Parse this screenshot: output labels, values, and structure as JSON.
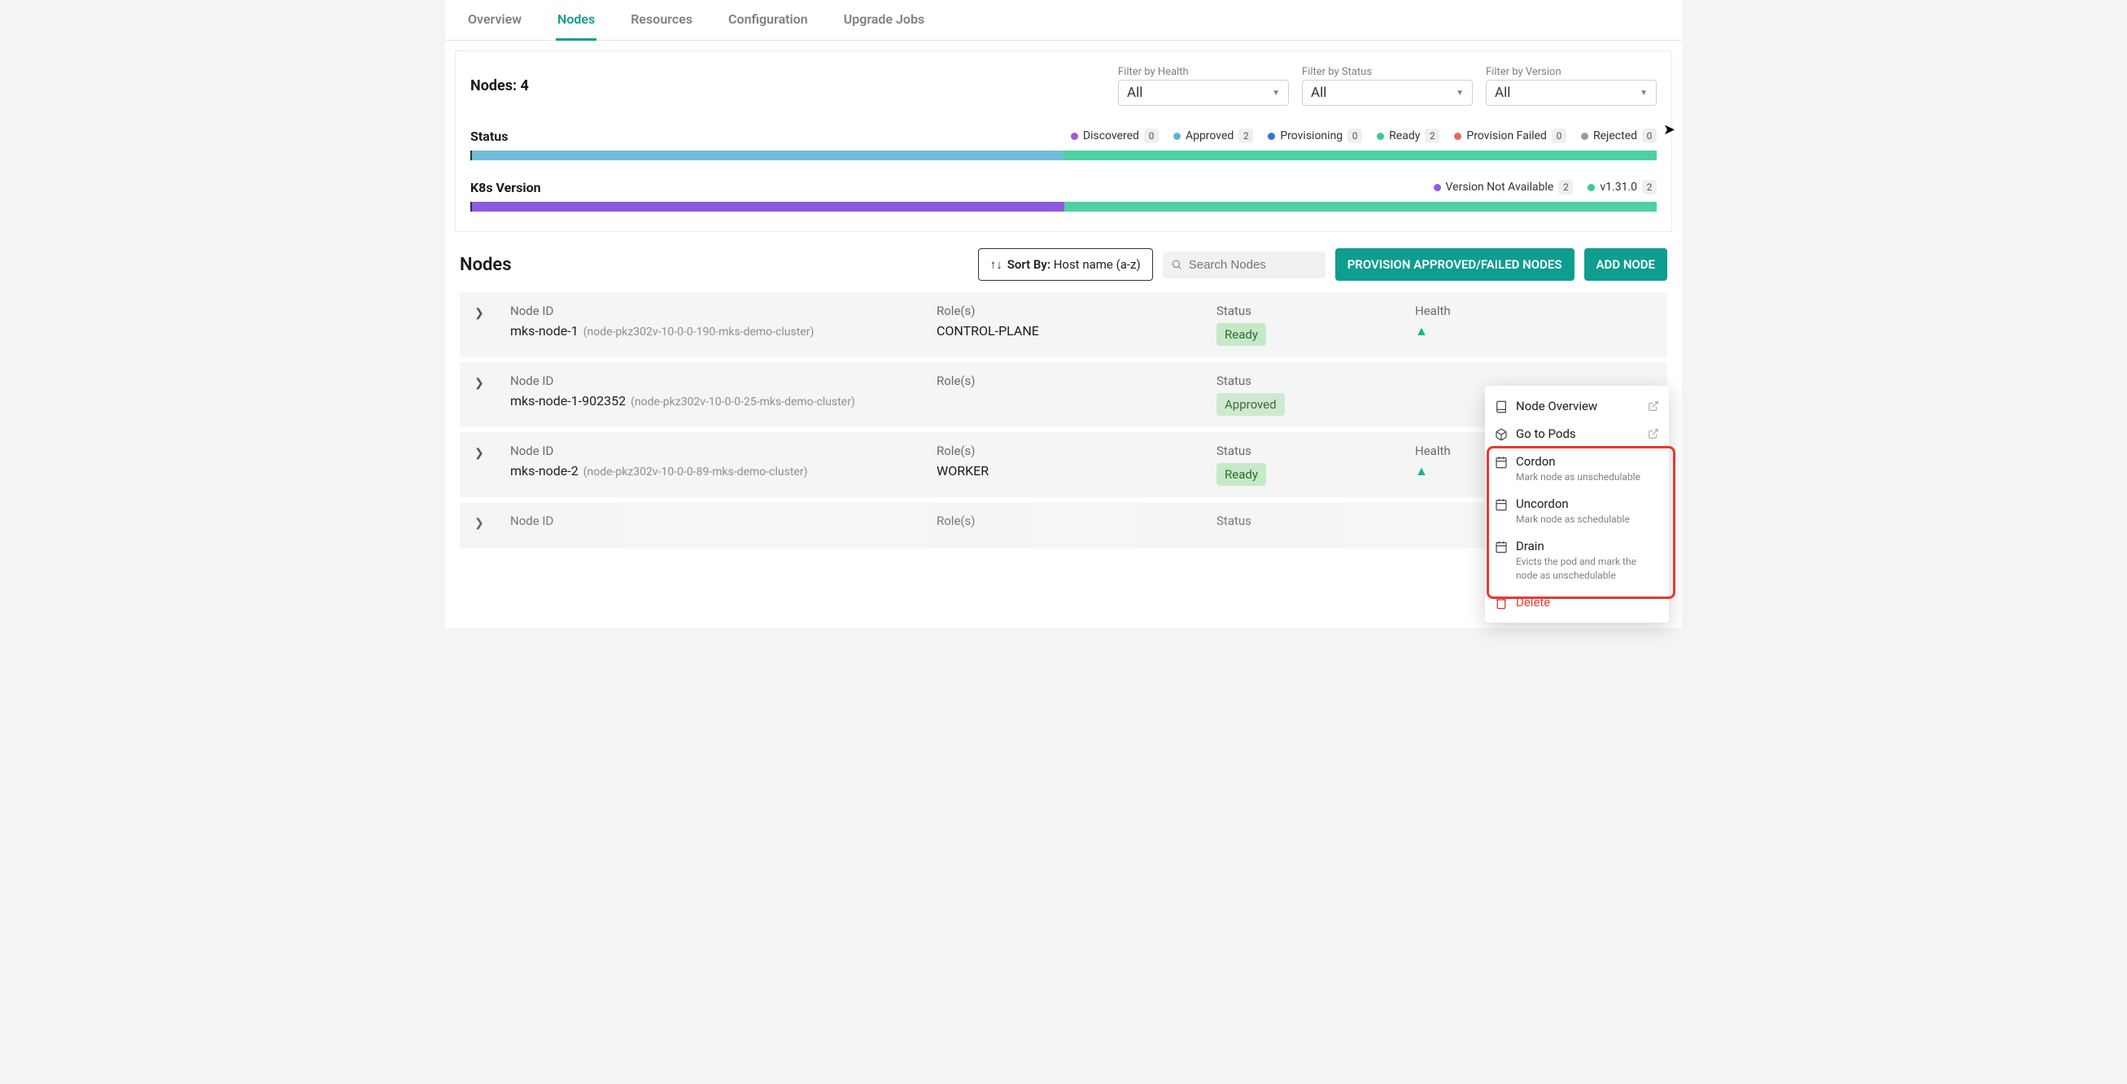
{
  "tabs": {
    "overview": "Overview",
    "nodes": "Nodes",
    "resources": "Resources",
    "configuration": "Configuration",
    "upgrade": "Upgrade Jobs",
    "active": "nodes"
  },
  "summary": {
    "nodes_label": "Nodes:",
    "nodes_count": "4",
    "filters": {
      "health": {
        "label": "Filter by Health",
        "value": "All"
      },
      "status": {
        "label": "Filter by Status",
        "value": "All"
      },
      "version": {
        "label": "Filter by Version",
        "value": "All"
      }
    },
    "status": {
      "title": "Status",
      "legend": [
        {
          "label": "Discovered",
          "count": "0",
          "color": "#9c5bd6"
        },
        {
          "label": "Approved",
          "count": "2",
          "color": "#5bb6d6"
        },
        {
          "label": "Provisioning",
          "count": "0",
          "color": "#3772e0"
        },
        {
          "label": "Ready",
          "count": "2",
          "color": "#38c99a"
        },
        {
          "label": "Provision Failed",
          "count": "0",
          "color": "#e86a5c"
        },
        {
          "label": "Rejected",
          "count": "0",
          "color": "#9a9a9a"
        }
      ],
      "bar": [
        {
          "color": "#6fbdd8",
          "pct": 50
        },
        {
          "color": "#4ed0a3",
          "pct": 50
        }
      ]
    },
    "k8s": {
      "title": "K8s Version",
      "legend": [
        {
          "label": "Version Not Available",
          "count": "2",
          "color": "#8a5ce0"
        },
        {
          "label": "v1.31.0",
          "count": "2",
          "color": "#38c99a"
        }
      ],
      "bar": [
        {
          "color": "#8a5ce0",
          "pct": 50
        },
        {
          "color": "#4ed0a3",
          "pct": 50
        }
      ]
    }
  },
  "toolbar": {
    "heading": "Nodes",
    "sort_prefix": "Sort By:",
    "sort_value": "Host name (a-z)",
    "search_placeholder": "Search Nodes",
    "provision": "PROVISION APPROVED/FAILED NODES",
    "add": "ADD NODE"
  },
  "columns": {
    "node_id": "Node ID",
    "roles": "Role(s)",
    "status": "Status",
    "health": "Health"
  },
  "rows": [
    {
      "name": "mks-node-1",
      "sub": "(node-pkz302v-10-0-0-190-mks-demo-cluster)",
      "role": "CONTROL-PLANE",
      "status": "Ready",
      "status_class": "badge-ready",
      "health": true
    },
    {
      "name": "mks-node-1-902352",
      "sub": "(node-pkz302v-10-0-0-25-mks-demo-cluster)",
      "role": "",
      "status": "Approved",
      "status_class": "badge-approved",
      "health": false
    },
    {
      "name": "mks-node-2",
      "sub": "(node-pkz302v-10-0-0-89-mks-demo-cluster)",
      "role": "WORKER",
      "status": "Ready",
      "status_class": "badge-ready",
      "health": true
    },
    {
      "name": "",
      "sub": "",
      "role": "",
      "status": "",
      "status_class": "",
      "health": false
    }
  ],
  "context_menu": {
    "overview": "Node Overview",
    "pods": "Go to Pods",
    "cordon": {
      "title": "Cordon",
      "desc": "Mark node as unschedulable"
    },
    "uncordon": {
      "title": "Uncordon",
      "desc": "Mark node as schedulable"
    },
    "drain": {
      "title": "Drain",
      "desc": "Evicts the pod and mark the node as unschedulable"
    },
    "delete": "Delete"
  }
}
